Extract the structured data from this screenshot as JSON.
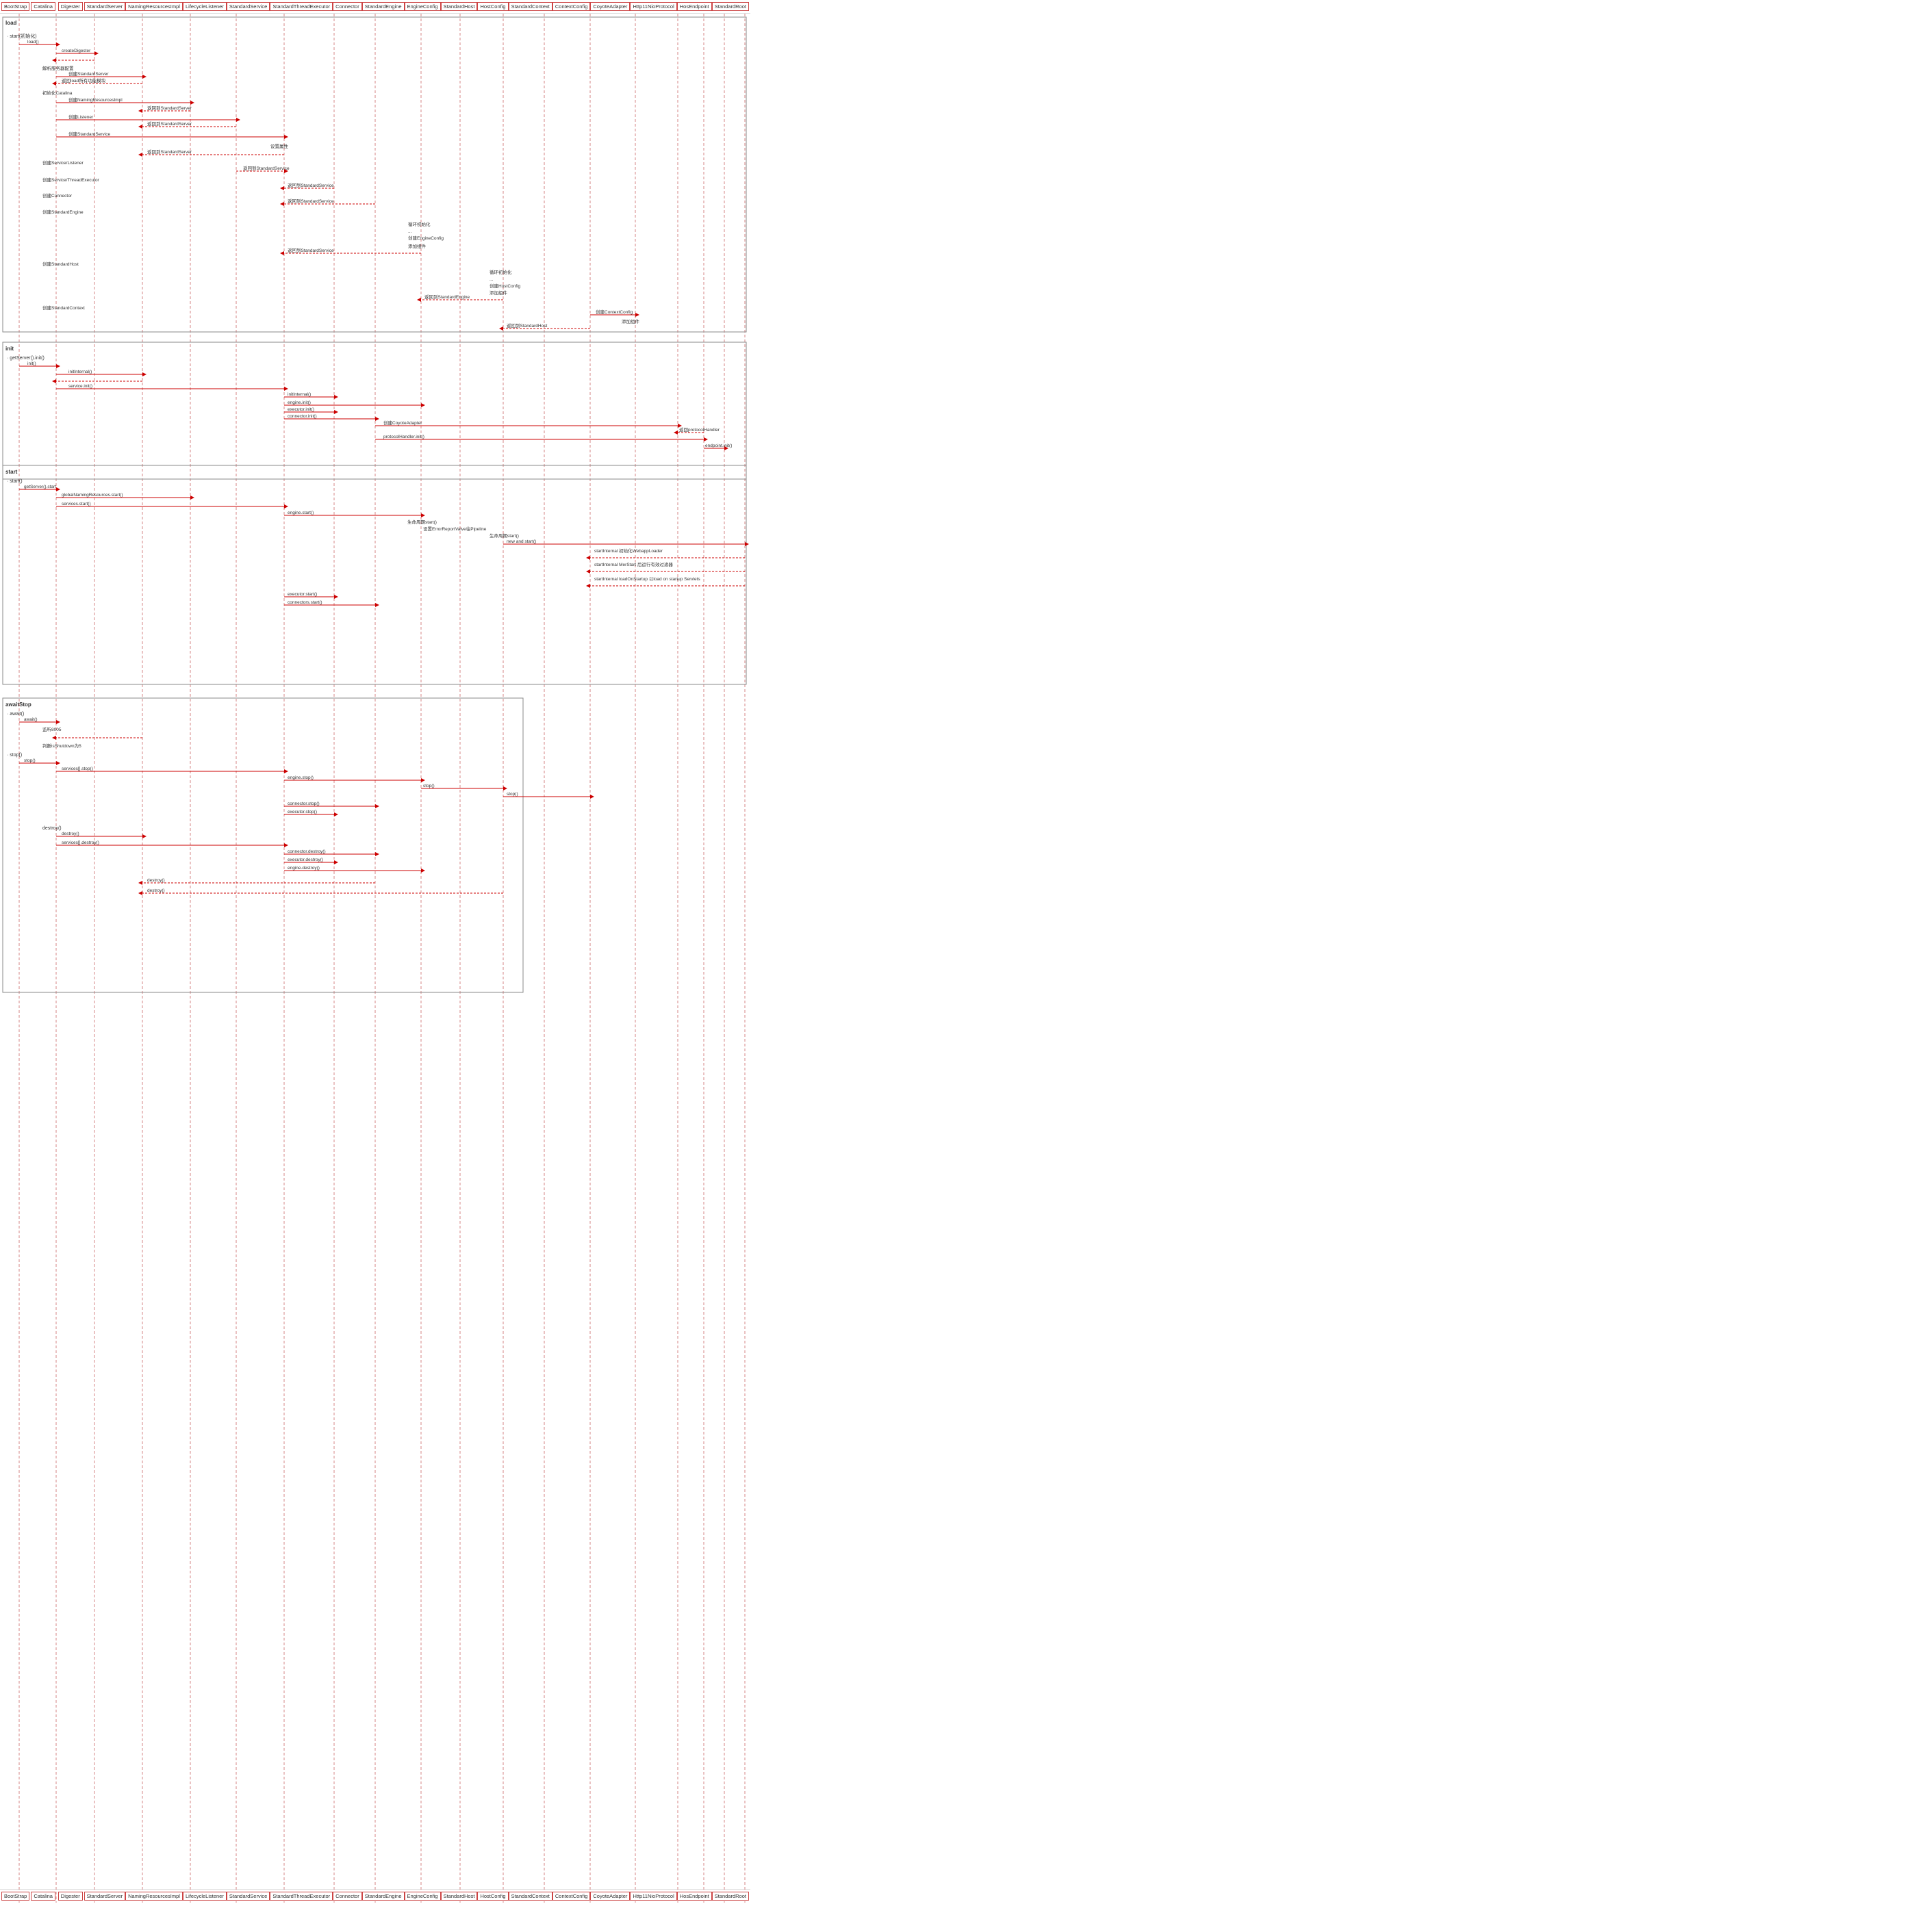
{
  "actors": [
    "BootStrap",
    "Catalina",
    "Digester",
    "StandardServer",
    "NamingResourcesImpl",
    "LifecycleListener",
    "StandardService",
    "StandardThreadExecutor",
    "Connector",
    "StandardEngine",
    "EngineConfig",
    "StandardHost",
    "HostConfig",
    "StandardContext",
    "ContextConfig",
    "CoyoteAdapter",
    "Http11NioProtocol",
    "HosEndpoint",
    "StandardRoot"
  ],
  "sections": [
    {
      "name": "load",
      "label": "load"
    },
    {
      "name": "init",
      "label": "init"
    },
    {
      "name": "start",
      "label": "start"
    },
    {
      "name": "awaitStop",
      "label": "awaitStop"
    }
  ],
  "colors": {
    "actor_border": "#c44444",
    "actor_bg": "#ffffff",
    "lifeline": "#cc4444",
    "arrow": "#cc0000",
    "frame_border": "#888888"
  }
}
